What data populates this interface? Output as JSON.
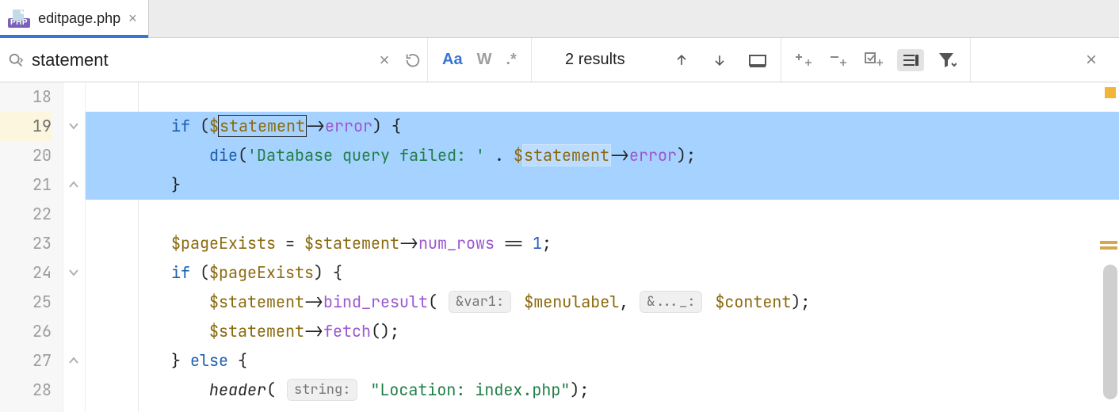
{
  "tab": {
    "filename": "editpage.php",
    "icon_badge": "PHP"
  },
  "search": {
    "query": "statement",
    "results_label": "2 results",
    "match_case_active": true
  },
  "code": {
    "first_line": 18,
    "lines": [
      {
        "n": 18,
        "sel": false,
        "fold": null,
        "tokens": []
      },
      {
        "n": 19,
        "sel": true,
        "fold": "down",
        "tokens": [
          {
            "t": "ind",
            "v": "        "
          },
          {
            "t": "kw",
            "v": "if"
          },
          {
            "t": "pun",
            "v": " ("
          },
          {
            "t": "var",
            "v": "$"
          },
          {
            "t": "match-dark",
            "v": "statement"
          },
          {
            "t": "arrow",
            "v": "->"
          },
          {
            "t": "prop",
            "v": "error"
          },
          {
            "t": "pun",
            "v": ") {"
          }
        ]
      },
      {
        "n": 20,
        "sel": true,
        "fold": null,
        "tokens": [
          {
            "t": "ind",
            "v": "            "
          },
          {
            "t": "kw",
            "v": "die"
          },
          {
            "t": "pun",
            "v": "("
          },
          {
            "t": "str",
            "v": "'Database query failed: '"
          },
          {
            "t": "pun",
            "v": " . "
          },
          {
            "t": "var",
            "v": "$"
          },
          {
            "t": "match-light",
            "v": "statement"
          },
          {
            "t": "arrow",
            "v": "->"
          },
          {
            "t": "prop",
            "v": "error"
          },
          {
            "t": "pun",
            "v": ");"
          }
        ]
      },
      {
        "n": 21,
        "sel": true,
        "fold": "up",
        "tokens": [
          {
            "t": "ind",
            "v": "        "
          },
          {
            "t": "pun",
            "v": "}"
          }
        ]
      },
      {
        "n": 22,
        "sel": false,
        "fold": null,
        "tokens": []
      },
      {
        "n": 23,
        "sel": false,
        "fold": null,
        "tokens": [
          {
            "t": "ind",
            "v": "        "
          },
          {
            "t": "var",
            "v": "$pageExists"
          },
          {
            "t": "pun",
            "v": " = "
          },
          {
            "t": "var",
            "v": "$statement"
          },
          {
            "t": "arrow",
            "v": "->"
          },
          {
            "t": "prop",
            "v": "num_rows"
          },
          {
            "t": "pun",
            "v": " == "
          },
          {
            "t": "num",
            "v": "1"
          },
          {
            "t": "pun",
            "v": ";"
          }
        ]
      },
      {
        "n": 24,
        "sel": false,
        "fold": "down",
        "tokens": [
          {
            "t": "ind",
            "v": "        "
          },
          {
            "t": "kw",
            "v": "if"
          },
          {
            "t": "pun",
            "v": " ("
          },
          {
            "t": "var",
            "v": "$pageExists"
          },
          {
            "t": "pun",
            "v": ") {"
          }
        ]
      },
      {
        "n": 25,
        "sel": false,
        "fold": null,
        "tokens": [
          {
            "t": "ind",
            "v": "            "
          },
          {
            "t": "var",
            "v": "$statement"
          },
          {
            "t": "arrow",
            "v": "->"
          },
          {
            "t": "prop",
            "v": "bind_result"
          },
          {
            "t": "pun",
            "v": "( "
          },
          {
            "t": "hint",
            "v": "&var1:"
          },
          {
            "t": "pun",
            "v": " "
          },
          {
            "t": "var",
            "v": "$menulabel"
          },
          {
            "t": "pun",
            "v": ", "
          },
          {
            "t": "hint",
            "v": "&..._:"
          },
          {
            "t": "pun",
            "v": " "
          },
          {
            "t": "var",
            "v": "$content"
          },
          {
            "t": "pun",
            "v": ");"
          }
        ]
      },
      {
        "n": 26,
        "sel": false,
        "fold": null,
        "tokens": [
          {
            "t": "ind",
            "v": "            "
          },
          {
            "t": "var",
            "v": "$statement"
          },
          {
            "t": "arrow",
            "v": "->"
          },
          {
            "t": "prop",
            "v": "fetch"
          },
          {
            "t": "pun",
            "v": "();"
          }
        ]
      },
      {
        "n": 27,
        "sel": false,
        "fold": "up",
        "tokens": [
          {
            "t": "ind",
            "v": "        "
          },
          {
            "t": "pun",
            "v": "} "
          },
          {
            "t": "kw",
            "v": "else"
          },
          {
            "t": "pun",
            "v": " {"
          }
        ]
      },
      {
        "n": 28,
        "sel": false,
        "fold": null,
        "tokens": [
          {
            "t": "ind",
            "v": "            "
          },
          {
            "t": "fit",
            "v": "header"
          },
          {
            "t": "pun",
            "v": "( "
          },
          {
            "t": "hint",
            "v": "string:"
          },
          {
            "t": "pun",
            "v": " "
          },
          {
            "t": "str",
            "v": "\"Location: index.php\""
          },
          {
            "t": "pun",
            "v": ");"
          }
        ]
      }
    ]
  },
  "icons": {
    "close_x": "×",
    "reset": "↻",
    "match_case": "Aa",
    "whole_word": "W",
    "regex": ".*",
    "arrow_up": "↑",
    "arrow_down": "↓"
  }
}
